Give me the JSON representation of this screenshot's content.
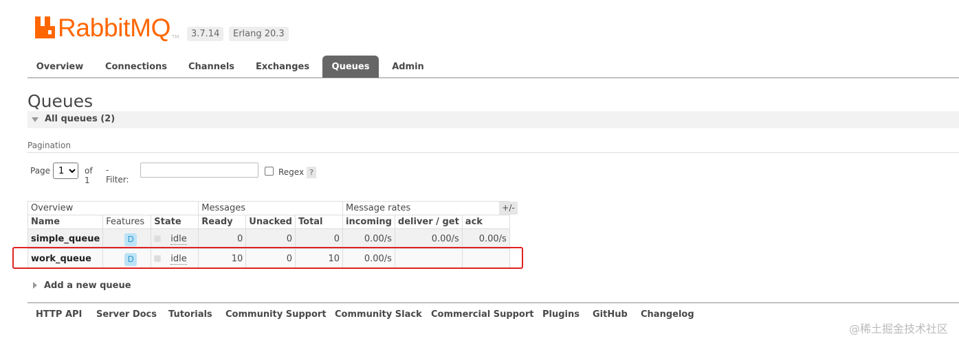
{
  "header": {
    "logo_text": "RabbitMQ",
    "logo_tm": "TM",
    "version": "3.7.14",
    "erlang": "Erlang 20.3"
  },
  "tabs": [
    {
      "label": "Overview",
      "active": false
    },
    {
      "label": "Connections",
      "active": false
    },
    {
      "label": "Channels",
      "active": false
    },
    {
      "label": "Exchanges",
      "active": false
    },
    {
      "label": "Queues",
      "active": true
    },
    {
      "label": "Admin",
      "active": false
    }
  ],
  "page": {
    "title": "Queues",
    "section_label": "All queues (2)"
  },
  "pagination": {
    "section_label": "Pagination",
    "page_label": "Page",
    "page_value": "1",
    "of_label": "of 1",
    "filter_label": "- Filter:",
    "filter_value": "",
    "regex_label": "Regex",
    "regex_checked": false,
    "help_label": "?"
  },
  "table": {
    "group_headers": [
      "Overview",
      "Messages",
      "Message rates"
    ],
    "columns": [
      "Name",
      "Features",
      "State",
      "Ready",
      "Unacked",
      "Total",
      "incoming",
      "deliver / get",
      "ack"
    ],
    "toggle_label": "+/-",
    "rows": [
      {
        "name": "simple_queue",
        "feature": "D",
        "state": "idle",
        "ready": "0",
        "unacked": "0",
        "total": "0",
        "incoming": "0.00/s",
        "deliver_get": "0.00/s",
        "ack": "0.00/s"
      },
      {
        "name": "work_queue",
        "feature": "D",
        "state": "idle",
        "ready": "10",
        "unacked": "0",
        "total": "10",
        "incoming": "0.00/s",
        "deliver_get": "",
        "ack": ""
      }
    ]
  },
  "add_queue_label": "Add a new queue",
  "footer": [
    "HTTP API",
    "Server Docs",
    "Tutorials",
    "Community Support",
    "Community Slack",
    "Commercial Support",
    "Plugins",
    "GitHub",
    "Changelog"
  ],
  "watermark": "@稀土掘金技术社区",
  "colors": {
    "brand": "#ff6600",
    "active_tab": "#666666",
    "highlight": "#e02020",
    "feature_badge": "#bde3f6"
  }
}
